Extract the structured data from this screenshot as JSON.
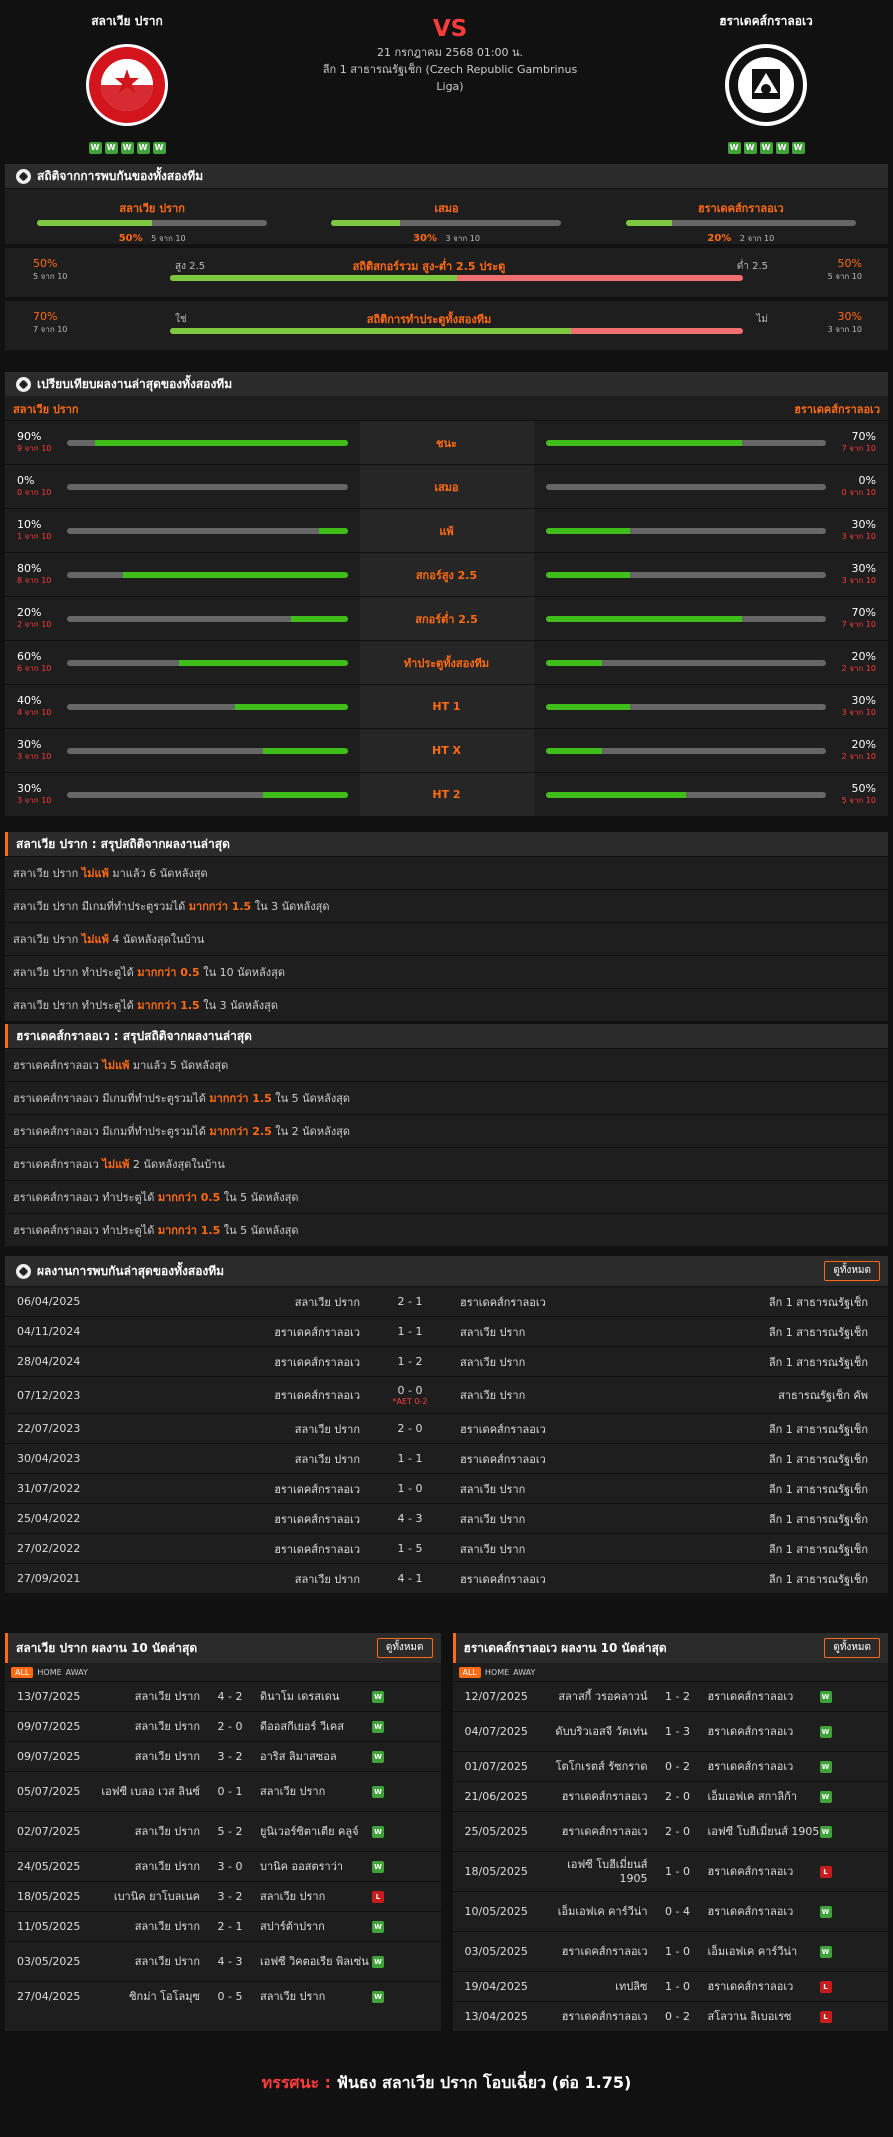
{
  "header": {
    "home": "สลาเวีย ปราก",
    "away": "ฮราเดคส์กราลอเว",
    "vs": "VS",
    "datetime": "21 กรกฎาคม 2568 01:00 น.",
    "league": "ลีก 1 สาธารณรัฐเช็ก (Czech Republic Gambrinus Liga)",
    "home_form": [
      "W",
      "W",
      "W",
      "W",
      "W"
    ],
    "away_form": [
      "W",
      "W",
      "W",
      "W",
      "W"
    ],
    "home_logo_text": "SK SLAVIA PRAHA FOTBAL",
    "away_logo_text": "FC HRADEC KRÁLOVÉ 1905"
  },
  "h2h_stats": {
    "title": "สถิติจากการพบกันของทั้งสองทีม",
    "cols": [
      {
        "label": "สลาเวีย ปราก",
        "pct": "50%",
        "of": "5 จาก 10",
        "value": 0.5
      },
      {
        "label": "เสมอ",
        "pct": "30%",
        "of": "3 จาก 10",
        "value": 0.3
      },
      {
        "label": "ฮราเดคส์กราลอเว",
        "pct": "20%",
        "of": "2 จาก 10",
        "value": 0.2
      }
    ],
    "ou": {
      "title": "สถิติสกอร์รวม สูง-ต่ำ 2.5 ประตู",
      "left_pct": "50%",
      "left_of": "5 จาก 10",
      "right_pct": "50%",
      "right_of": "5 จาก 10",
      "left_label": "สูง 2.5",
      "right_label": "ต่ำ 2.5",
      "value": 0.5
    },
    "btts": {
      "title": "สถิติการทำประตูทั้งสองทีม",
      "left_pct": "70%",
      "left_of": "7 จาก 10",
      "right_pct": "30%",
      "right_of": "3 จาก 10",
      "left_label": "ใช่",
      "right_label": "ไม่",
      "value": 0.7
    }
  },
  "compare": {
    "title": "เปรียบเทียบผลงานล่าสุดของทั้งสองทีม",
    "home": "สลาเวีย ปราก",
    "away": "ฮราเดคส์กราลอเว",
    "rows": [
      {
        "label": "ชนะ",
        "hp": "90%",
        "ho": "9 จาก 10",
        "hv": 0.9,
        "ap": "70%",
        "ao": "7 จาก 10",
        "av": 0.7
      },
      {
        "label": "เสมอ",
        "hp": "0%",
        "ho": "0 จาก 10",
        "hv": 0,
        "ap": "0%",
        "ao": "0 จาก 10",
        "av": 0
      },
      {
        "label": "แพ้",
        "hp": "10%",
        "ho": "1 จาก 10",
        "hv": 0.1,
        "ap": "30%",
        "ao": "3 จาก 10",
        "av": 0.3
      },
      {
        "label": "สกอร์สูง 2.5",
        "hp": "80%",
        "ho": "8 จาก 10",
        "hv": 0.8,
        "ap": "30%",
        "ao": "3 จาก 10",
        "av": 0.3
      },
      {
        "label": "สกอร์ต่ำ 2.5",
        "hp": "20%",
        "ho": "2 จาก 10",
        "hv": 0.2,
        "ap": "70%",
        "ao": "7 จาก 10",
        "av": 0.7
      },
      {
        "label": "ทำประตูทั้งสองทีม",
        "hp": "60%",
        "ho": "6 จาก 10",
        "hv": 0.6,
        "ap": "20%",
        "ao": "2 จาก 10",
        "av": 0.2
      },
      {
        "label": "HT 1",
        "hp": "40%",
        "ho": "4 จาก 10",
        "hv": 0.4,
        "ap": "30%",
        "ao": "3 จาก 10",
        "av": 0.3
      },
      {
        "label": "HT X",
        "hp": "30%",
        "ho": "3 จาก 10",
        "hv": 0.3,
        "ap": "20%",
        "ao": "2 จาก 10",
        "av": 0.2
      },
      {
        "label": "HT 2",
        "hp": "30%",
        "ho": "3 จาก 10",
        "hv": 0.3,
        "ap": "50%",
        "ao": "5 จาก 10",
        "av": 0.5
      }
    ]
  },
  "home_summary": {
    "title": "สลาเวีย ปราก : สรุปสถิติจากผลงานล่าสุด",
    "items": [
      [
        "สลาเวีย ปราก ",
        "ไม่แพ้",
        " มาแล้ว 6 นัดหลังสุด"
      ],
      [
        "สลาเวีย ปราก มีเกมที่ทำประตูรวมได้ ",
        "มากกว่า 1.5",
        " ใน 3 นัดหลังสุด"
      ],
      [
        "สลาเวีย ปราก ",
        "ไม่แพ้",
        " 4 นัดหลังสุดในบ้าน"
      ],
      [
        "สลาเวีย ปราก ทำประตูได้ ",
        "มากกว่า 0.5",
        " ใน 10 นัดหลังสุด"
      ],
      [
        "สลาเวีย ปราก ทำประตูได้ ",
        "มากกว่า 1.5",
        " ใน 3 นัดหลังสุด"
      ]
    ]
  },
  "away_summary": {
    "title": "ฮราเดคส์กราลอเว : สรุปสถิติจากผลงานล่าสุด",
    "items": [
      [
        "ฮราเดคส์กราลอเว ",
        "ไม่แพ้",
        " มาแล้ว 5 นัดหลังสุด"
      ],
      [
        "ฮราเดคส์กราลอเว มีเกมที่ทำประตูรวมได้ ",
        "มากกว่า 1.5",
        " ใน 5 นัดหลังสุด"
      ],
      [
        "ฮราเดคส์กราลอเว มีเกมที่ทำประตูรวมได้ ",
        "มากกว่า 2.5",
        " ใน 2 นัดหลังสุด"
      ],
      [
        "ฮราเดคส์กราลอเว ",
        "ไม่แพ้",
        " 2 นัดหลังสุดในบ้าน"
      ],
      [
        "ฮราเดคส์กราลอเว ทำประตูได้ ",
        "มากกว่า 0.5",
        " ใน 5 นัดหลังสุด"
      ],
      [
        "ฮราเดคส์กราลอเว ทำประตูได้ ",
        "มากกว่า 1.5",
        " ใน 5 นัดหลังสุด"
      ]
    ]
  },
  "h2h_results": {
    "title": "ผลงานการพบกันล่าสุดของทั้งสองทีม",
    "view_all": "ดูทั้งหมด",
    "rows": [
      [
        "06/04/2025",
        "สลาเวีย ปราก",
        "2 - 1",
        "ฮราเดคส์กราลอเว",
        "ลีก 1 สาธารณรัฐเช็ก",
        ""
      ],
      [
        "04/11/2024",
        "ฮราเดคส์กราลอเว",
        "1 - 1",
        "สลาเวีย ปราก",
        "ลีก 1 สาธารณรัฐเช็ก",
        ""
      ],
      [
        "28/04/2024",
        "ฮราเดคส์กราลอเว",
        "1 - 2",
        "สลาเวีย ปราก",
        "ลีก 1 สาธารณรัฐเช็ก",
        ""
      ],
      [
        "07/12/2023",
        "ฮราเดคส์กราลอเว",
        "0 - 0",
        "สลาเวีย ปราก",
        "สาธารณรัฐเช็ก คัพ",
        "*AET 0-2"
      ],
      [
        "22/07/2023",
        "สลาเวีย ปราก",
        "2 - 0",
        "ฮราเดคส์กราลอเว",
        "ลีก 1 สาธารณรัฐเช็ก",
        ""
      ],
      [
        "30/04/2023",
        "สลาเวีย ปราก",
        "1 - 1",
        "ฮราเดคส์กราลอเว",
        "ลีก 1 สาธารณรัฐเช็ก",
        ""
      ],
      [
        "31/07/2022",
        "ฮราเดคส์กราลอเว",
        "1 - 0",
        "สลาเวีย ปราก",
        "ลีก 1 สาธารณรัฐเช็ก",
        ""
      ],
      [
        "25/04/2022",
        "ฮราเดคส์กราลอเว",
        "4 - 3",
        "สลาเวีย ปราก",
        "ลีก 1 สาธารณรัฐเช็ก",
        ""
      ],
      [
        "27/02/2022",
        "ฮราเดคส์กราลอเว",
        "1 - 5",
        "สลาเวีย ปราก",
        "ลีก 1 สาธารณรัฐเช็ก",
        ""
      ],
      [
        "27/09/2021",
        "สลาเวีย ปราก",
        "4 - 1",
        "ฮราเดคส์กราลอเว",
        "ลีก 1 สาธารณรัฐเช็ก",
        ""
      ]
    ]
  },
  "home_last10": {
    "title": "สลาเวีย ปราก ผลงาน 10 นัดล่าสุด",
    "view_all": "ดูทั้งหมด",
    "tabs": [
      "ALL",
      "HOME",
      "AWAY"
    ],
    "rows": [
      [
        "13/07/2025",
        "สลาเวีย ปราก",
        "4 - 2",
        "ดินาโม เดรสเดน",
        "W"
      ],
      [
        "09/07/2025",
        "สลาเวีย ปราก",
        "2 - 0",
        "ดีออสกีเยอร์ วีเคส",
        "W"
      ],
      [
        "09/07/2025",
        "สลาเวีย ปราก",
        "3 - 2",
        "อาริส ลิมาสซอล",
        "W"
      ],
      [
        "05/07/2025",
        "เอฟซี เบลอ เวส ลินซ์",
        "0 - 1",
        "สลาเวีย ปราก",
        "W"
      ],
      [
        "02/07/2025",
        "สลาเวีย ปราก",
        "5 - 2",
        "ยูนิเวอร์ซิตาเตีย คลูจ์",
        "W"
      ],
      [
        "24/05/2025",
        "สลาเวีย ปราก",
        "3 - 0",
        "บานิค ออสตราว่า",
        "W"
      ],
      [
        "18/05/2025",
        "เบานิค ยาโบลเนค",
        "3 - 2",
        "สลาเวีย ปราก",
        "L"
      ],
      [
        "11/05/2025",
        "สลาเวีย ปราก",
        "2 - 1",
        "สปาร์ต้าปราก",
        "W"
      ],
      [
        "03/05/2025",
        "สลาเวีย ปราก",
        "4 - 3",
        "เอฟซี วิคตอเรีย พิลเซ่น",
        "W"
      ],
      [
        "27/04/2025",
        "ซิกม่า โอโลมุซ",
        "0 - 5",
        "สลาเวีย ปราก",
        "W"
      ]
    ]
  },
  "away_last10": {
    "title": "ฮราเดคส์กราลอเว ผลงาน 10 นัดล่าสุด",
    "view_all": "ดูทั้งหมด",
    "tabs": [
      "ALL",
      "HOME",
      "AWAY"
    ],
    "rows": [
      [
        "12/07/2025",
        "สลาสกี้ วรอคลาวน์",
        "1 - 2",
        "ฮราเดคส์กราลอเว",
        "W"
      ],
      [
        "04/07/2025",
        "ดับบริวเอสจี วัตเท่น",
        "1 - 3",
        "ฮราเดคส์กราลอเว",
        "W"
      ],
      [
        "01/07/2025",
        "โตโกเรตส์ รัซกราด",
        "0 - 2",
        "ฮราเดคส์กราลอเว",
        "W"
      ],
      [
        "21/06/2025",
        "ฮราเดคส์กราลอเว",
        "2 - 0",
        "เอ็มเอฟเค สกาลิก้า",
        "W"
      ],
      [
        "25/05/2025",
        "ฮราเดคส์กราลอเว",
        "2 - 0",
        "เอฟซี โบฮีเมี่ยนส์ 1905",
        "W"
      ],
      [
        "18/05/2025",
        "เอฟซี โบฮีเมี่ยนส์ 1905",
        "1 - 0",
        "ฮราเดคส์กราลอเว",
        "L"
      ],
      [
        "10/05/2025",
        "เอ็มเอฟเค คาร์วีน่า",
        "0 - 4",
        "ฮราเดคส์กราลอเว",
        "W"
      ],
      [
        "03/05/2025",
        "ฮราเดคส์กราลอเว",
        "1 - 0",
        "เอ็มเอฟเค คาร์วีน่า",
        "W"
      ],
      [
        "19/04/2025",
        "เทปลิซ",
        "1 - 0",
        "ฮราเดคส์กราลอเว",
        "L"
      ],
      [
        "13/04/2025",
        "ฮราเดคส์กราลอเว",
        "0 - 2",
        "สโลวาน ลิเบอเรซ",
        "L"
      ]
    ]
  },
  "tip": {
    "label": "ทรรศนะ :",
    "text": "ฟันธง สลาเวีย ปราก โอบเฉี่ยว (ต่อ 1.75)"
  }
}
